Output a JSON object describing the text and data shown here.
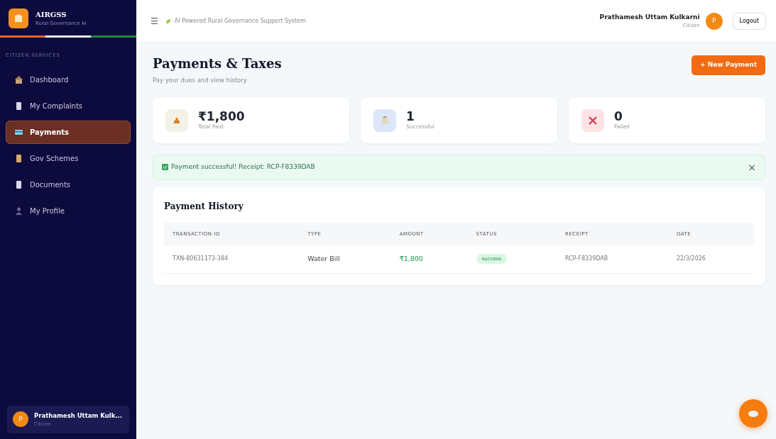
{
  "brand": {
    "title": "AIRGSS",
    "subtitle": "Rural Governance AI"
  },
  "sidebar": {
    "section": "CITIZEN SERVICES",
    "items": [
      {
        "label": "Dashboard",
        "kind": "home",
        "selected": false
      },
      {
        "label": "My Complaints",
        "kind": "doc",
        "selected": false
      },
      {
        "label": "Payments",
        "kind": "card",
        "selected": true
      },
      {
        "label": "Gov Schemes",
        "kind": "book",
        "selected": false
      },
      {
        "label": "Documents",
        "kind": "doc",
        "selected": false
      },
      {
        "label": "My Profile",
        "kind": "person",
        "selected": false
      }
    ],
    "user": {
      "initial": "P",
      "name": "Prathamesh Uttam Kulk...",
      "role": "Citizen"
    }
  },
  "topbar": {
    "menu": "☰",
    "tagline": "AI Powered Rural Governance Support System",
    "user_name": "Prathamesh Uttam Kulkarni",
    "user_role": "Citizen",
    "initial": "P",
    "logout": "Logout"
  },
  "page": {
    "title": "Payments & Taxes",
    "subtitle": "Pay your dues and view history",
    "new_button": "+ New Payment"
  },
  "stats": [
    {
      "kind": "money",
      "value": "₹1,800",
      "label": "Total Paid"
    },
    {
      "kind": "clipboard",
      "value": "1",
      "label": "Successful"
    },
    {
      "kind": "failed",
      "value": "0",
      "label": "Failed"
    }
  ],
  "alert": {
    "text": "Payment successful! Receipt: RCP-F8339DAB",
    "close": "×"
  },
  "history": {
    "title": "Payment History",
    "columns": [
      "TRANSACTION ID",
      "TYPE",
      "AMOUNT",
      "STATUS",
      "RECEIPT",
      "DATE"
    ],
    "rows": [
      {
        "id": "TXN-80631173-384",
        "type": "Water Bill",
        "amount": "₹1,800",
        "status": "success",
        "receipt": "RCP-F8339DAB",
        "date": "22/3/2026"
      }
    ]
  }
}
